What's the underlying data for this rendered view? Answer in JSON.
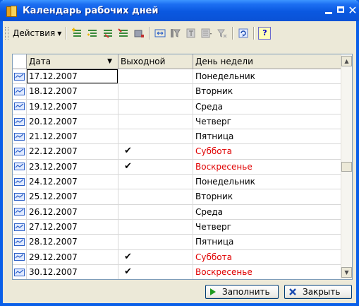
{
  "window": {
    "title": "Календарь рабочих дней"
  },
  "toolbar": {
    "actions_label": "Действия",
    "help_label": "?"
  },
  "table": {
    "columns": [
      "Дата",
      "Выходной",
      "День недели"
    ],
    "rows": [
      {
        "date": "17.12.2007",
        "holiday": "",
        "weekday": "Понедельник",
        "weekend": false
      },
      {
        "date": "18.12.2007",
        "holiday": "",
        "weekday": "Вторник",
        "weekend": false
      },
      {
        "date": "19.12.2007",
        "holiday": "",
        "weekday": "Среда",
        "weekend": false
      },
      {
        "date": "20.12.2007",
        "holiday": "",
        "weekday": "Четверг",
        "weekend": false
      },
      {
        "date": "21.12.2007",
        "holiday": "",
        "weekday": "Пятница",
        "weekend": false
      },
      {
        "date": "22.12.2007",
        "holiday": "✔",
        "weekday": "Суббота",
        "weekend": true
      },
      {
        "date": "23.12.2007",
        "holiday": "✔",
        "weekday": "Воскресенье",
        "weekend": true
      },
      {
        "date": "24.12.2007",
        "holiday": "",
        "weekday": "Понедельник",
        "weekend": false
      },
      {
        "date": "25.12.2007",
        "holiday": "",
        "weekday": "Вторник",
        "weekend": false
      },
      {
        "date": "26.12.2007",
        "holiday": "",
        "weekday": "Среда",
        "weekend": false
      },
      {
        "date": "27.12.2007",
        "holiday": "",
        "weekday": "Четверг",
        "weekend": false
      },
      {
        "date": "28.12.2007",
        "holiday": "",
        "weekday": "Пятница",
        "weekend": false
      },
      {
        "date": "29.12.2007",
        "holiday": "✔",
        "weekday": "Суббота",
        "weekend": true
      },
      {
        "date": "30.12.2007",
        "holiday": "✔",
        "weekday": "Воскресенье",
        "weekend": true
      }
    ]
  },
  "buttons": {
    "fill_label": "Заполнить",
    "close_label": "Закрыть"
  },
  "colors": {
    "titlebar": "#0a58e0",
    "weekend_text": "#e00000",
    "window_bg": "#ece9d8"
  }
}
